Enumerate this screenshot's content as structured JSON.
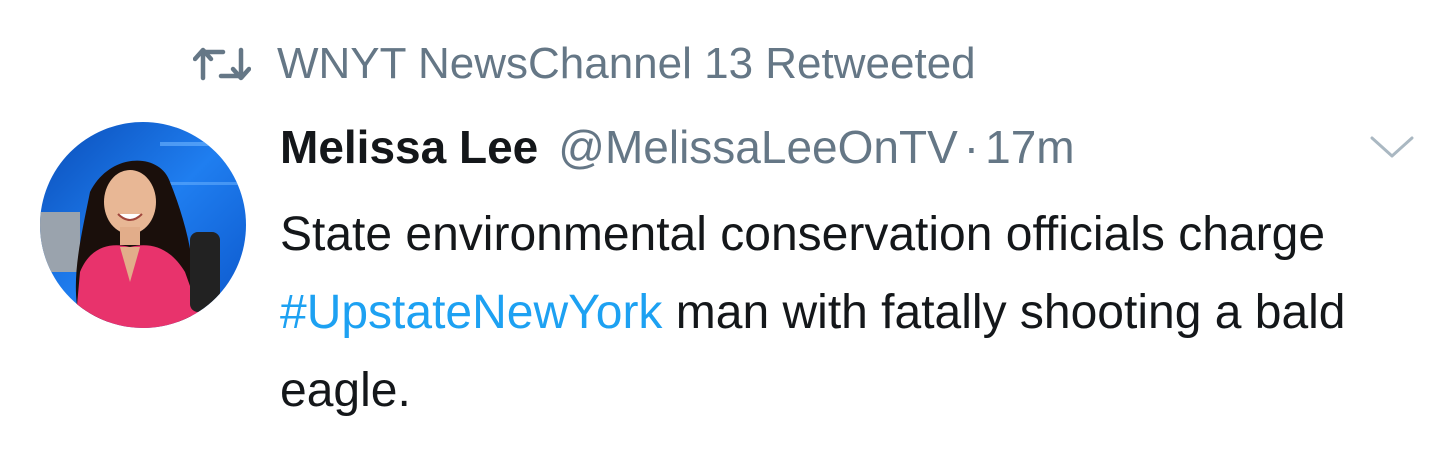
{
  "social_context": {
    "icon": "retweet-icon",
    "text": "WNYT NewsChannel 13 Retweeted"
  },
  "tweet": {
    "display_name": "Melissa Lee",
    "handle": "@MelissaLeeOnTV",
    "separator": "·",
    "timestamp": "17m",
    "text_before": "State environmental conservation officials charge ",
    "hashtag": "#UpstateNewYork",
    "text_after": " man with fatally shooting a bald eagle.",
    "menu_icon": "chevron-down-icon",
    "avatar_icon": "avatar"
  },
  "colors": {
    "secondary_text": "#657786",
    "primary_text": "#14171a",
    "link": "#1da1f2"
  }
}
